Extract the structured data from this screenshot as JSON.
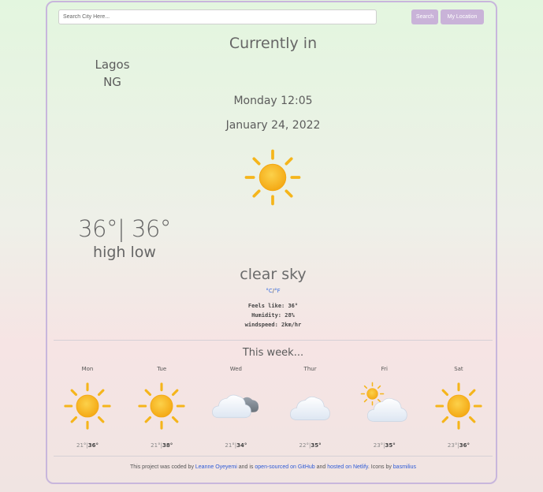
{
  "search": {
    "placeholder": "Search City Here...",
    "button_label": "Search",
    "location_label": "My Location"
  },
  "current": {
    "heading": "Currently in",
    "city": "Lagos",
    "country": "NG",
    "day_time": "Monday 12:05",
    "date": "January 24, 2022",
    "icon": "sun-icon",
    "temps": "36°| 36°",
    "high_low_label": "high low",
    "description": "clear sky",
    "unit_c": "°C",
    "unit_sep": "/",
    "unit_f": "°F",
    "feels_like": "Feels like: 36°",
    "humidity": "Humidity: 28%",
    "windspeed": "windspeed: 2km/hr"
  },
  "week": {
    "title": "This week...",
    "days": [
      {
        "name": "Mon",
        "icon": "sun-icon",
        "low": "21°",
        "high": "36°"
      },
      {
        "name": "Tue",
        "icon": "sun-icon",
        "low": "21°",
        "high": "38°"
      },
      {
        "name": "Wed",
        "icon": "cloudy-icon",
        "low": "21°",
        "high": "34°"
      },
      {
        "name": "Thur",
        "icon": "cloud-icon",
        "low": "22°",
        "high": "35°"
      },
      {
        "name": "Fri",
        "icon": "partly-cloudy-icon",
        "low": "23°",
        "high": "35°"
      },
      {
        "name": "Sat",
        "icon": "sun-icon",
        "low": "23°",
        "high": "36°"
      }
    ]
  },
  "footer": {
    "t1": "This project was coded by ",
    "author": "Leanne Oyeyemi",
    "t2": " and is ",
    "github": "open-sourced on GitHub",
    "t3": " and ",
    "netlify": "hosted on Netlify",
    "t4": ". Icons by ",
    "icons_by": "basmilius"
  },
  "colors": {
    "accent": "#c9b3d8",
    "link": "#2e5bd6",
    "sun": "#f5b51b"
  }
}
